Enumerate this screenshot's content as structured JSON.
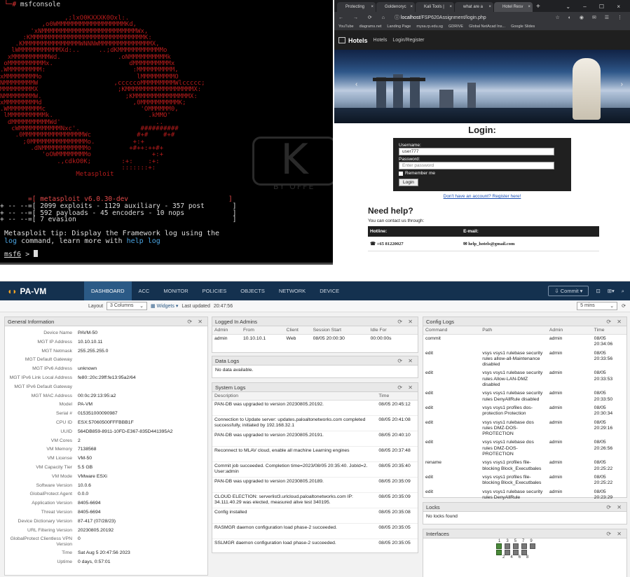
{
  "terminal": {
    "title": "msfconsole",
    "art_lines": [
      "                 ,;lxO0KXXXK0Oxl:.",
      "           ,o0WMMMMMMMMMMMMMMMMMMKd,",
      "        'xNMMMMMMMMMMMMMMMMMMMMMMMMMWx,",
      "      :KMMMMMMMMMMMMMMMMMMMMMMMMMMMMMMK:",
      "    .KMMMMMMMMMMMMMMMWNNNWMMMMMMMMMMMMMMX,",
      "   lWMMMMMMMMMMMXd:..     ..;dKMMMMMMMMMMMMo",
      "  xMMMMMMMMMMWd.               .oNMMMMMMMMMMk",
      " oMMMMMMMMMMx.                    dMMMMMMMMMMx",
      ".WMMMMMMMMM:                       :MMMMMMMMMM,",
      "xMMMMMMMMMo                         lMMMMMMMMMO",
      "NMMMMMMMMW                    ,cccccoMMMMMMMMMWlccccc;",
      "MMMMMMMMMX                     ;KMMMMMMMMMMMMMMMMMMX:",
      "NMMMMMMMMW.                      ;KMMMMMMMMMMMMMMMX:",
      "xMMMMMMMMMd                        ,0MMMMMMMMMMK;",
      ".WMMMMMMMMMc                         'OMMMMMM0,",
      " lMMMMMMMMMMk.                         .kMMO'",
      "  dMMMMMMMMMMWd'                         ..",
      "   cWMMMMMMMMMMMNxc'.                ##########",
      "    .0MMMMMMMMMMMMMMMMWc            #+#    #+#",
      "      ;0MMMMMMMMMMMMMMMo.          +:+",
      "        .dNMMMMMMMMMMMMo          +#++:++#+",
      "           'oOWMMMMMMMMo                +:+",
      "               .,cdkO0K;        :+:    :+:",
      "                                :::::::+:",
      "                    Metasploit"
    ],
    "watermark": "K",
    "watermark_text": "BY OFFE",
    "version_line": "       =[ metasploit v6.0.30-dev                         ]",
    "banner_lines": [
      "+ -- --=[ 2099 exploits - 1129 auxiliary - 357 post       ]",
      "+ -- --=[ 592 payloads - 45 encoders - 10 nops            ]",
      "+ -- --=[ 7 evasion                                       ]"
    ],
    "tip_pre": "Metasploit tip: Display the Framework log using the",
    "tip_cmd1": "log",
    "tip_mid": " command, learn more with ",
    "tip_cmd2": "help log",
    "prompt": "msf6",
    "prompt_suffix": " > "
  },
  "browser": {
    "tabs": [
      {
        "label": "Protecting"
      },
      {
        "label": "Goldenoryc"
      },
      {
        "label": "Kali Tools |"
      },
      {
        "label": "what are a"
      },
      {
        "label": "Hotel Resv"
      }
    ],
    "url_host": "localhost",
    "url_path": "/FSP620Assignment/login.php",
    "bookmarks": [
      "YouTube",
      "diagrams.net",
      "Landing Page",
      "mysa.rp.edu.sg",
      "GDRIVE",
      "Global NetAcad Ins...",
      "Google Slides"
    ],
    "site": {
      "brand": "Hotels",
      "nav": [
        "Hotels",
        "Login/Register"
      ]
    },
    "login": {
      "title": "Login:",
      "username_label": "Username:",
      "username_value": "user777",
      "password_label": "Password:",
      "password_placeholder": "Enter password",
      "remember_label": "Remember me",
      "button": "Login",
      "register_link": "Don't have an account? Register here!"
    },
    "help": {
      "title": "Need help?",
      "subtitle": "You can contact us through:",
      "col1": "Hotline:",
      "col2": "E-mail:",
      "hotline": "+65 81220027",
      "email": "help_hotels@gmail.com"
    }
  },
  "pavm": {
    "brand": "PA-VM",
    "tabs": [
      "DASHBOARD",
      "ACC",
      "MONITOR",
      "POLICIES",
      "OBJECTS",
      "NETWORK",
      "DEVICE"
    ],
    "active_tab": "DASHBOARD",
    "commit": "Commit",
    "toolbar": {
      "layout_label": "Layout",
      "layout_value": "3 Columns",
      "widgets": "Widgets",
      "last_updated_label": "Last updated",
      "last_updated_value": "20:47:56",
      "refresh_value": "5 mins"
    },
    "general_info": {
      "title": "General Information",
      "rows": [
        {
          "k": "Device Name",
          "v": "PAVM-50"
        },
        {
          "k": "MGT IP Address",
          "v": "10.10.10.11"
        },
        {
          "k": "MGT Netmask",
          "v": "255.255.255.0"
        },
        {
          "k": "MGT Default Gateway",
          "v": ""
        },
        {
          "k": "MGT IPv6 Address",
          "v": "unknown"
        },
        {
          "k": "MGT IPv6 Link Local Address",
          "v": "fe80::20c:29ff:fe13:95a2/64"
        },
        {
          "k": "MGT IPv6 Default Gateway",
          "v": ""
        },
        {
          "k": "MGT MAC Address",
          "v": "00:0c:29:13:95:a2"
        },
        {
          "k": "Model",
          "v": "PA-VM"
        },
        {
          "k": "Serial #",
          "v": "015351000090987"
        },
        {
          "k": "CPU ID",
          "v": "ESX:57060500FFFBBB1F"
        },
        {
          "k": "UUID",
          "v": "564DB859-8911-10FD-E367-835D441395A2"
        },
        {
          "k": "VM Cores",
          "v": "2"
        },
        {
          "k": "VM Memory",
          "v": "7138568"
        },
        {
          "k": "VM License",
          "v": "VM-50"
        },
        {
          "k": "VM Capacity Tier",
          "v": "5.5 GB"
        },
        {
          "k": "VM Mode",
          "v": "VMware ESXi"
        },
        {
          "k": "Software Version",
          "v": "10.0.6"
        },
        {
          "k": "GlobalProtect Agent",
          "v": "0.0.0"
        },
        {
          "k": "Application Version",
          "v": "8405-6694"
        },
        {
          "k": "Threat Version",
          "v": "8405-6694"
        },
        {
          "k": "Device Dictionary Version",
          "v": "87-417 (07/28/23)"
        },
        {
          "k": "URL Filtering Version",
          "v": "20230805.20192"
        },
        {
          "k": "GlobalProtect Clientless VPN Version",
          "v": "0"
        },
        {
          "k": "Time",
          "v": "Sat Aug 5 20:47:56 2023"
        },
        {
          "k": "Uptime",
          "v": "0 days, 0:57:01"
        }
      ]
    },
    "logged_in": {
      "title": "Logged In Admins",
      "headers": [
        "Admin",
        "From",
        "Client",
        "Session Start",
        "Idle For"
      ],
      "rows": [
        [
          "admin",
          "10.10.10.1",
          "Web",
          "08/05 20:00:30",
          "00:00:00s"
        ]
      ]
    },
    "data_logs": {
      "title": "Data Logs",
      "empty": "No data available."
    },
    "system_logs": {
      "title": "System Logs",
      "headers": [
        "Description",
        "Time"
      ],
      "rows": [
        [
          "PAN-DB was upgraded to version 20230805.20192.",
          "08/05 20:45:12"
        ],
        [
          "Connection to Update server: updates.paloaltonetworks.com completed successfully, initiated by 192.168.32.1",
          "08/05 20:41:08"
        ],
        [
          "PAN-DB was upgraded to version 20230805.20191.",
          "08/05 20:40:10"
        ],
        [
          "Reconnect to MLAV cloud, enable all machine Learning engines",
          "08/05 20:37:48"
        ],
        [
          "Commit job succeeded. Completion time=2023/08/05 20:35:40. JobId=2. User:admin",
          "08/05 20:35:40"
        ],
        [
          "PAN-DB was upgraded to version 20230805.20189.",
          "08/05 20:35:09"
        ],
        [
          "CLOUD ELECTION: serverlist3.urlcloud.paloaltonetworks.com IP: 34.111.40.29 was elected, measured alive test 340195.",
          "08/05 20:35:09"
        ],
        [
          "Config installed",
          "08/05 20:35:08"
        ],
        [
          "RASMGR daemon configuration load phase-2 succeeded.",
          "08/05 20:35:05"
        ],
        [
          "SSLMGR daemon configuration load phase-2 succeeded.",
          "08/05 20:35:05"
        ]
      ]
    },
    "config_logs": {
      "title": "Config Logs",
      "headers": [
        "Command",
        "Path",
        "Admin",
        "Time"
      ],
      "rows": [
        [
          "commit",
          "",
          "admin",
          "08/05 20:34:06"
        ],
        [
          "edit",
          "vsys vsys1 rulebase security rules allow-all-Maintenance disabled",
          "admin",
          "08/05 20:33:56"
        ],
        [
          "edit",
          "vsys vsys1 rulebase security rules Allow-LAN-DMZ disabled",
          "admin",
          "08/05 20:33:53"
        ],
        [
          "edit",
          "vsys vsys1 rulebase security rules DenyAllRule disabled",
          "admin",
          "08/05 20:33:50"
        ],
        [
          "edit",
          "vsys vsys1 profiles dos-protection Protection",
          "admin",
          "08/05 20:30:34"
        ],
        [
          "edit",
          "vsys vsys1 rulebase dos rules DMZ-DOS-PROTECTION",
          "admin",
          "08/05 20:29:16"
        ],
        [
          "edit",
          "vsys vsys1 rulebase dos rules DMZ-DOS-PROTECTION",
          "admin",
          "08/05 20:26:56"
        ],
        [
          "rename",
          "vsys vsys1 profiles file-blocking Block_Executbales",
          "admin",
          "08/05 20:25:22"
        ],
        [
          "edit",
          "vsys vsys1 profiles file-blocking Block_Executbales",
          "admin",
          "08/05 20:25:22"
        ],
        [
          "edit",
          "vsys vsys1 rulebase security rules DenyAllRule",
          "admin",
          "08/05 20:23:29"
        ]
      ]
    },
    "locks": {
      "title": "Locks",
      "empty": "No locks found"
    },
    "interfaces": {
      "title": "Interfaces",
      "top_nums": [
        "1",
        "3",
        "5",
        "7",
        "9"
      ],
      "bottom_nums": [
        "2",
        "4",
        "6",
        "8"
      ]
    }
  }
}
